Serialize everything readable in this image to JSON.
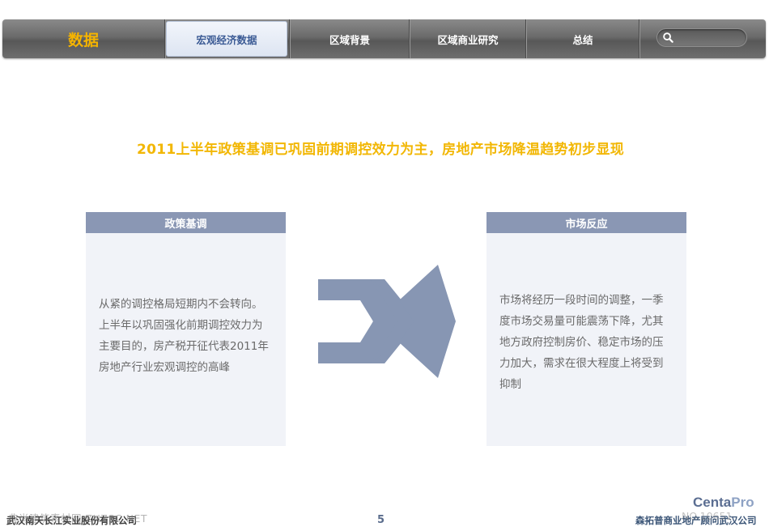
{
  "navbar": {
    "brand": "数据",
    "tabs": [
      {
        "label": "宏观经济数据",
        "active": true
      },
      {
        "label": "区域背景",
        "active": false
      },
      {
        "label": "区域商业研究",
        "active": false
      },
      {
        "label": "总结",
        "active": false
      }
    ],
    "search": {
      "placeholder": "",
      "icon": "search-icon"
    }
  },
  "main": {
    "headline": "2011上半年政策基调已巩固前期调控效力为主，房地产市场降温趋势初步显现",
    "left_panel": {
      "title": "政策基调",
      "body": "从紧的调控格局短期内不会转向。上半年以巩固强化前期调控效力为主要目的，房产税开征代表2011年房地产行业宏观调控的高峰"
    },
    "arrow": {
      "icon": "right-arrow-icon",
      "color": "#8796b3"
    },
    "right_panel": {
      "title": "市场反应",
      "body": "市场将经历一段时间的调整，一季度市场交易量可能震荡下降，尤其地方政府控制房价、稳定市场的压力加大，需求在很大程度上将受到抑制"
    }
  },
  "footer": {
    "left_text": "武汉南天长江实业股份有限公司",
    "page_number": "5",
    "right_text": "森拓普商业地产顾问武汉公司",
    "logo_main": "Centa",
    "logo_suffix": "Pro",
    "watermark": "典尚建筑素材网 ZHZSC.NET",
    "watermark_right": "NO.10651"
  },
  "colors": {
    "accent_yellow": "#f2b705",
    "panel_header": "#8a97b4",
    "panel_bg": "#f1f3f8",
    "nav_active_text": "#3a5a94"
  }
}
